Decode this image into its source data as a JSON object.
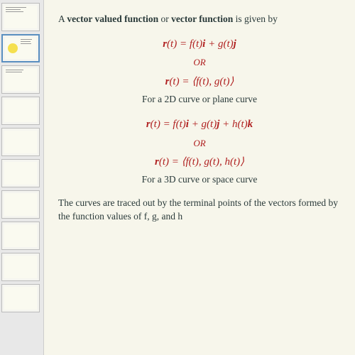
{
  "intro": {
    "prefix": "A ",
    "term1": "vector valued function",
    "mid": " or ",
    "term2": "vector function",
    "suffix": " is given by"
  },
  "block2d": {
    "eq1_r": "r",
    "eq1_text": "(t) = f(t)",
    "eq1_i": "i",
    "eq1_plus": " + g(t)",
    "eq1_j": "j",
    "or": "OR",
    "eq2_r": "r",
    "eq2_text": "(t) = ⟨f(t), g(t)⟩",
    "caption": "For a 2D curve or plane curve"
  },
  "block3d": {
    "eq1_r": "r",
    "eq1_a": "(t) = f(t)",
    "eq1_i": "i",
    "eq1_b": " + g(t)",
    "eq1_j": "j",
    "eq1_c": " + h(t)",
    "eq1_k": "k",
    "or": "OR",
    "eq2_r": "r",
    "eq2_text": "(t) = ⟨f(t), g(t), h(t)⟩",
    "caption": "For a 3D curve or space curve"
  },
  "footer": "The curves are traced out by the terminal points of the vectors formed by the function values of f, g, and h"
}
